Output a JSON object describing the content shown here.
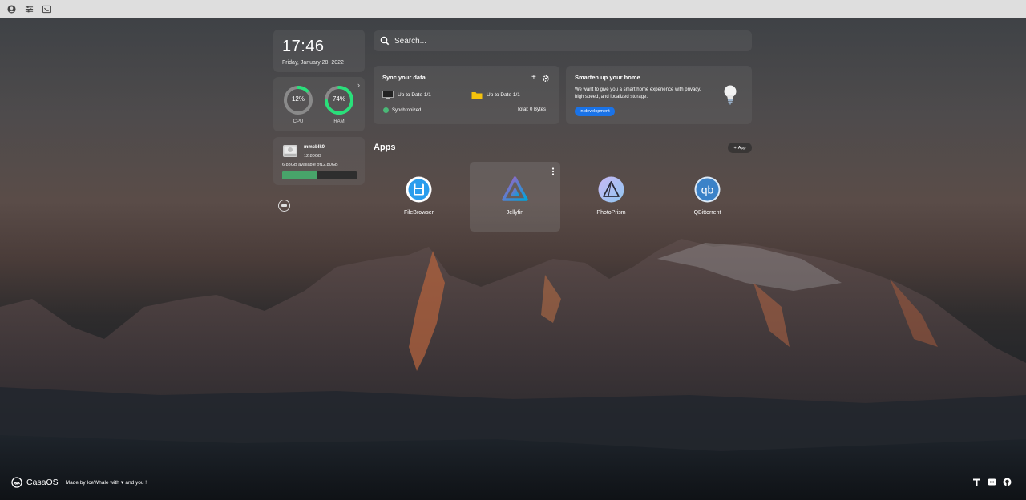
{
  "clock": {
    "time": "17:46",
    "date": "Friday, January 28, 2022"
  },
  "usage": {
    "cpu": {
      "label": "CPU",
      "percent": 12,
      "percent_text": "12%"
    },
    "ram": {
      "label": "RAM",
      "percent": 74,
      "percent_text": "74%"
    }
  },
  "storage": {
    "name": "mmcblk0",
    "size": "12.80GB",
    "available": "6.83GB available of12.80GB",
    "used_fraction": 0.47
  },
  "search": {
    "placeholder": "Search..."
  },
  "sync": {
    "title": "Sync your data",
    "device1": "Up to Date 1/1",
    "device2": "Up to Date 1/1",
    "status": "Synchronized",
    "total": "Total:   0 Bytes"
  },
  "smart": {
    "title": "Smarten up your home",
    "desc": "We want to give you a smart home experience with privacy, high speed, and localized storage.",
    "badge": "In development"
  },
  "apps": {
    "title": "Apps",
    "add_label": "App",
    "items": [
      {
        "name": "FileBrowser",
        "icon": "filebrowser-icon"
      },
      {
        "name": "Jellyfin",
        "icon": "jellyfin-icon"
      },
      {
        "name": "PhotoPrism",
        "icon": "photoprism-icon"
      },
      {
        "name": "QBittorrent",
        "icon": "qbittorrent-icon"
      }
    ]
  },
  "footer": {
    "brand": "CasaOS",
    "made_prefix": "Made by IceWhale with",
    "made_suffix": "and you !"
  },
  "colors": {
    "accent": "#1a73e8",
    "gauge_green": "#29e07a",
    "storage_bar": "#48a46a"
  }
}
